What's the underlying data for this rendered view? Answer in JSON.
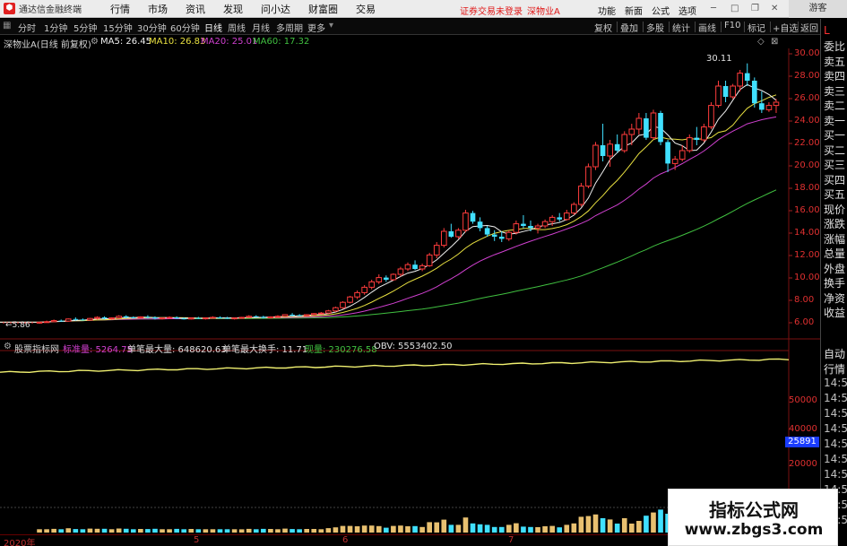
{
  "app": {
    "title": "通达信金融终端",
    "menu": [
      "行情",
      "市场",
      "资讯",
      "发现",
      "问小达",
      "财富圈",
      "交易"
    ],
    "login_status": "证券交易未登录",
    "stock_title": "深物业A",
    "right_menu": [
      "功能",
      "新面",
      "公式",
      "选项"
    ],
    "guest": "游客"
  },
  "periods": [
    "分时",
    "1分钟",
    "5分钟",
    "15分钟",
    "30分钟",
    "60分钟",
    "日线",
    "周线",
    "月线",
    "多周期",
    "更多"
  ],
  "active_period": "日线",
  "tools": [
    "复权",
    "叠加",
    "多股",
    "统计",
    "画线",
    "F10",
    "标记",
    "+自选",
    "返回"
  ],
  "chart_header": {
    "stock": "深物业A(日线 前复权)",
    "ma5": "MA5: 26.45",
    "ma10": "MA10: 26.83",
    "ma20": "MA20: 25.01",
    "ma60": "MA60: 17.32"
  },
  "colors": {
    "up": "#ff3c3c",
    "down": "#40e0ff",
    "ma5": "#f0f0f0",
    "ma10": "#e8e040",
    "ma20": "#d040d0",
    "ma60": "#40c040"
  },
  "price_axis": [
    "30.00",
    "28.00",
    "26.00",
    "24.00",
    "22.00",
    "20.00",
    "18.00",
    "16.00",
    "14.00",
    "12.00",
    "10.00",
    "8.00",
    "6.00"
  ],
  "annotations": {
    "high": "30.11",
    "low": "5.86"
  },
  "right_panel": {
    "head": "L",
    "items": [
      "委比",
      "卖五",
      "卖四",
      "卖三",
      "卖二",
      "卖一",
      "买一",
      "买二",
      "买三",
      "买四",
      "买五",
      "现价",
      "涨跌",
      "涨幅",
      "总量",
      "外盘",
      "换手",
      "净资",
      "收益"
    ],
    "bottom_items": [
      "自动",
      "行情",
      "14:5",
      "14:5",
      "14:5",
      "14:5",
      "14:5",
      "14:5",
      "14:5",
      "14:5",
      "14:5",
      "14:5"
    ]
  },
  "indicator_header": {
    "name": "股票指标网",
    "std_vol": "标准量: 5264.75",
    "max_vol": "单笔最大量: 648620.63",
    "max_turn": "单笔最大换手: 11.71",
    "now_vol": "现量: 230276.58",
    "obv": "OBV: 5553402.50"
  },
  "volume_axis": [
    "50000",
    "40000",
    "20000"
  ],
  "obv_badge": "25891",
  "date_axis": [
    "2020年",
    "5",
    "6",
    "7"
  ],
  "watermark": {
    "title": "指标公式网",
    "url": "www.zbgs3.com"
  },
  "chart_data": {
    "type": "candlestick",
    "ylim": [
      5,
      31
    ],
    "candles": [
      [
        6.0,
        6.1,
        5.9,
        6.05
      ],
      [
        6.05,
        6.2,
        6.0,
        6.1
      ],
      [
        6.1,
        6.3,
        6.05,
        6.2
      ],
      [
        6.2,
        6.3,
        6.1,
        6.15
      ],
      [
        6.15,
        6.4,
        6.1,
        6.35
      ],
      [
        6.35,
        6.5,
        6.2,
        6.3
      ],
      [
        6.3,
        6.4,
        6.2,
        6.25
      ],
      [
        6.25,
        6.45,
        6.2,
        6.4
      ],
      [
        6.4,
        6.6,
        6.3,
        6.5
      ],
      [
        6.5,
        6.6,
        6.3,
        6.4
      ],
      [
        6.4,
        6.5,
        6.3,
        6.45
      ],
      [
        6.45,
        6.7,
        6.4,
        6.6
      ],
      [
        6.6,
        6.7,
        6.4,
        6.5
      ],
      [
        6.5,
        6.6,
        6.4,
        6.45
      ],
      [
        6.45,
        6.6,
        6.4,
        6.55
      ],
      [
        6.55,
        6.7,
        6.4,
        6.5
      ],
      [
        6.5,
        6.6,
        6.3,
        6.4
      ],
      [
        6.4,
        6.5,
        6.3,
        6.45
      ],
      [
        6.45,
        6.6,
        6.4,
        6.5
      ],
      [
        6.5,
        6.6,
        6.35,
        6.4
      ],
      [
        6.4,
        6.5,
        6.3,
        6.35
      ],
      [
        6.35,
        6.5,
        6.3,
        6.45
      ],
      [
        6.45,
        6.55,
        6.35,
        6.4
      ],
      [
        6.4,
        6.5,
        6.3,
        6.45
      ],
      [
        6.45,
        6.6,
        6.4,
        6.5
      ],
      [
        6.5,
        6.6,
        6.4,
        6.45
      ],
      [
        6.45,
        6.55,
        6.35,
        6.4
      ],
      [
        6.4,
        6.5,
        6.3,
        6.45
      ],
      [
        6.45,
        6.55,
        6.4,
        6.5
      ],
      [
        6.5,
        6.7,
        6.45,
        6.6
      ],
      [
        6.6,
        6.7,
        6.5,
        6.55
      ],
      [
        6.55,
        6.65,
        6.4,
        6.45
      ],
      [
        6.45,
        6.6,
        6.4,
        6.55
      ],
      [
        6.55,
        6.7,
        6.5,
        6.6
      ],
      [
        6.6,
        6.8,
        6.55,
        6.75
      ],
      [
        6.75,
        6.9,
        6.6,
        6.7
      ],
      [
        6.7,
        6.8,
        6.6,
        6.65
      ],
      [
        6.65,
        6.8,
        6.6,
        6.75
      ],
      [
        6.75,
        6.9,
        6.7,
        6.85
      ],
      [
        6.85,
        7.0,
        6.8,
        6.9
      ],
      [
        6.9,
        7.2,
        6.85,
        7.1
      ],
      [
        7.1,
        7.5,
        7.0,
        7.4
      ],
      [
        7.4,
        8.0,
        7.3,
        7.9
      ],
      [
        7.9,
        8.5,
        7.8,
        8.4
      ],
      [
        8.4,
        9.0,
        8.2,
        8.8
      ],
      [
        8.8,
        9.5,
        8.6,
        9.3
      ],
      [
        9.3,
        10.0,
        9.1,
        9.8
      ],
      [
        9.8,
        10.5,
        9.6,
        10.2
      ],
      [
        10.2,
        10.4,
        9.8,
        10.0
      ],
      [
        10.0,
        10.6,
        9.9,
        10.5
      ],
      [
        10.5,
        11.2,
        10.3,
        11.0
      ],
      [
        11.0,
        11.6,
        10.8,
        11.4
      ],
      [
        11.4,
        11.8,
        10.9,
        11.0
      ],
      [
        11.0,
        11.5,
        10.8,
        11.3
      ],
      [
        11.3,
        12.5,
        11.2,
        12.3
      ],
      [
        12.3,
        13.5,
        12.0,
        13.2
      ],
      [
        13.2,
        14.8,
        13.0,
        14.5
      ],
      [
        14.5,
        15.2,
        13.9,
        14.0
      ],
      [
        14.0,
        14.8,
        13.8,
        14.6
      ],
      [
        14.6,
        16.5,
        14.4,
        16.2
      ],
      [
        16.2,
        16.4,
        15.2,
        15.4
      ],
      [
        15.4,
        15.8,
        14.5,
        14.8
      ],
      [
        14.8,
        15.0,
        14.0,
        14.2
      ],
      [
        14.2,
        14.6,
        13.6,
        14.0
      ],
      [
        14.0,
        14.5,
        13.5,
        13.8
      ],
      [
        13.8,
        14.6,
        13.6,
        14.4
      ],
      [
        14.4,
        15.5,
        14.2,
        15.2
      ],
      [
        15.2,
        16.0,
        14.8,
        15.0
      ],
      [
        15.0,
        15.5,
        14.5,
        14.8
      ],
      [
        14.8,
        15.2,
        14.3,
        15.0
      ],
      [
        15.0,
        15.6,
        14.8,
        15.4
      ],
      [
        15.4,
        16.0,
        15.0,
        15.8
      ],
      [
        15.8,
        16.2,
        15.4,
        15.6
      ],
      [
        15.6,
        16.5,
        15.5,
        16.2
      ],
      [
        16.2,
        17.2,
        16.0,
        17.0
      ],
      [
        17.0,
        19.0,
        16.8,
        18.7
      ],
      [
        18.7,
        20.8,
        18.5,
        20.5
      ],
      [
        20.5,
        22.8,
        20.2,
        22.5
      ],
      [
        22.5,
        24.5,
        21.0,
        21.5
      ],
      [
        21.5,
        23.0,
        20.5,
        22.6
      ],
      [
        22.6,
        23.5,
        21.8,
        22.0
      ],
      [
        22.0,
        23.8,
        21.8,
        23.5
      ],
      [
        23.5,
        24.5,
        22.5,
        24.0
      ],
      [
        24.0,
        25.5,
        23.5,
        25.0
      ],
      [
        25.0,
        25.5,
        23.0,
        23.2
      ],
      [
        23.2,
        25.8,
        23.0,
        25.5
      ],
      [
        25.5,
        25.7,
        22.5,
        22.8
      ],
      [
        22.8,
        23.0,
        20.0,
        20.8
      ],
      [
        20.8,
        21.5,
        20.2,
        21.2
      ],
      [
        21.2,
        22.5,
        21.0,
        22.0
      ],
      [
        22.0,
        23.5,
        21.8,
        23.2
      ],
      [
        23.2,
        24.2,
        22.5,
        23.0
      ],
      [
        23.0,
        24.5,
        22.8,
        24.2
      ],
      [
        24.2,
        26.5,
        24.0,
        26.2
      ],
      [
        26.2,
        28.5,
        26.0,
        28.0
      ],
      [
        28.0,
        28.5,
        26.5,
        27.0
      ],
      [
        27.0,
        28.2,
        26.8,
        28.0
      ],
      [
        28.0,
        29.5,
        27.5,
        29.2
      ],
      [
        29.2,
        30.11,
        28.0,
        28.5
      ],
      [
        28.5,
        28.8,
        26.0,
        26.4
      ],
      [
        26.4,
        27.5,
        25.5,
        25.8
      ],
      [
        25.8,
        26.5,
        25.6,
        26.2
      ],
      [
        26.2,
        26.8,
        25.5,
        26.5
      ]
    ],
    "volume_line": {
      "from": 62000,
      "to": 67000
    }
  }
}
